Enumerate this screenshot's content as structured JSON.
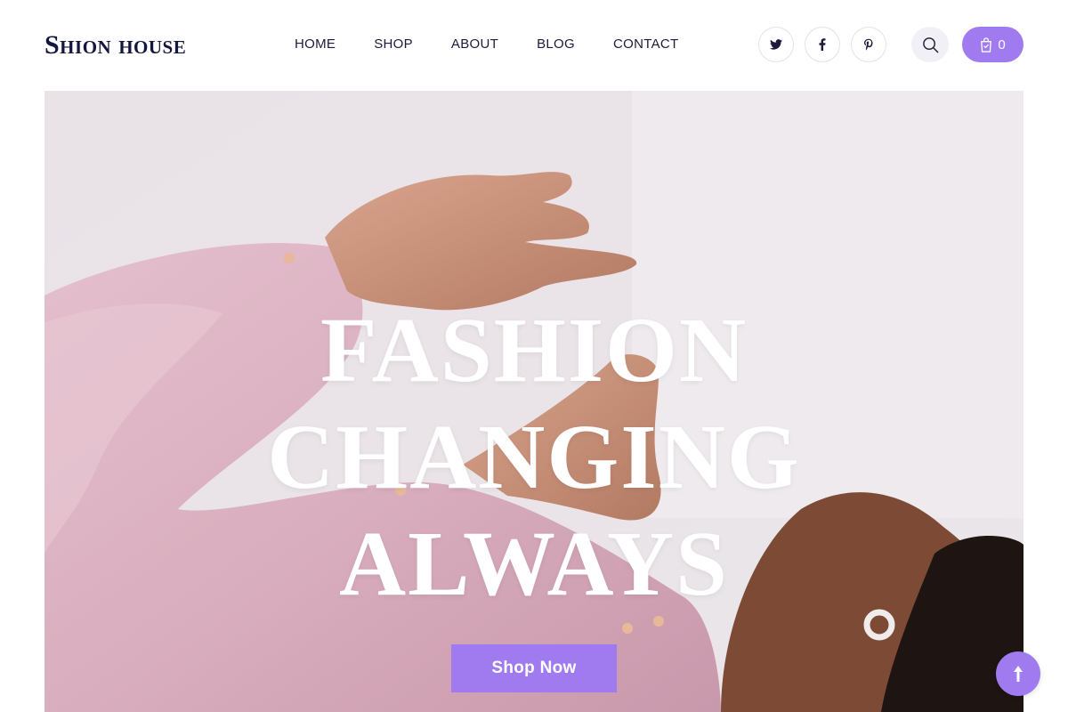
{
  "brand": {
    "logo_text": "Shion house"
  },
  "nav": {
    "items": [
      {
        "label": "HOME"
      },
      {
        "label": "SHOP"
      },
      {
        "label": "ABOUT"
      },
      {
        "label": "BLOG"
      },
      {
        "label": "CONTACT"
      }
    ]
  },
  "social": [
    {
      "name": "twitter-icon"
    },
    {
      "name": "facebook-icon"
    },
    {
      "name": "pinterest-icon"
    }
  ],
  "cart": {
    "count": "0",
    "icon": "shopping-bag-icon"
  },
  "search": {
    "icon": "search-icon"
  },
  "hero": {
    "title_lines": [
      "FASHION",
      "CHANGING",
      "ALWAYS"
    ],
    "cta_label": "Shop Now"
  },
  "scroll_top": {
    "icon": "arrow-up-icon"
  },
  "colors": {
    "accent": "#a07bf0",
    "text_dark": "#14173d",
    "hero_bg": "#e4dbe1"
  }
}
